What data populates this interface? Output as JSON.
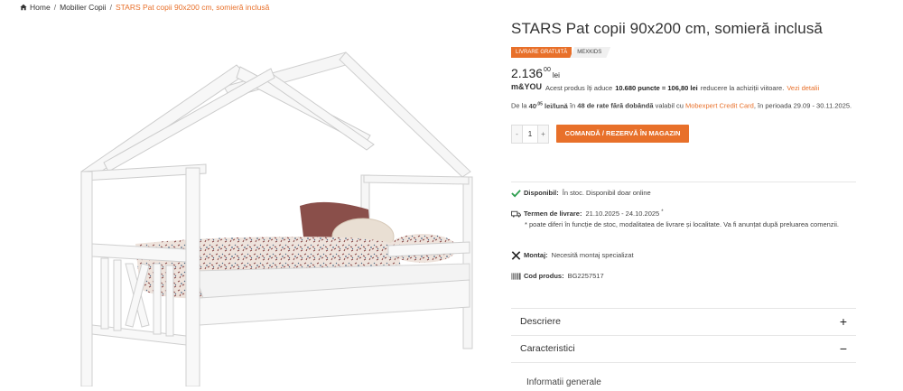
{
  "breadcrumb": {
    "home": "Home",
    "category": "Mobilier Copii",
    "current": "STARS Pat copii 90x200 cm, somieră inclusă",
    "separator": "/"
  },
  "product": {
    "title": "STARS Pat copii 90x200 cm, somieră inclusă",
    "badges": {
      "delivery": "Livrare gratuită",
      "brand": "MEXKIDS"
    },
    "price": {
      "integer": "2.136",
      "decimals": "00",
      "currency": "lei"
    }
  },
  "loyalty": {
    "logo_text": "m&YOU",
    "text_1": "Acest produs îți aduce",
    "points": "10.680 puncte = 106,80 lei",
    "text_2": "reducere la achiziții viitoare.",
    "link": "Vezi detalii"
  },
  "installments": {
    "prefix": "De la",
    "amount_int": "40",
    "amount_dec": ",05",
    "amount_suffix": "lei/lună",
    "in": "în",
    "count": "48 de rate fără dobândă",
    "valid": "valabil cu",
    "card": "Mobexpert Credit Card",
    "period": ", în perioada 29.09 - 30.11.2025."
  },
  "purchase": {
    "minus": "-",
    "quantity": "1",
    "plus": "+",
    "order_button": "Comandă / Rezervă în magazin"
  },
  "availability": {
    "label": "Disponibil:",
    "value": "În stoc. Disponibil doar online"
  },
  "delivery_term": {
    "label": "Termen de livrare:",
    "value": "21.10.2025 - 24.10.2025",
    "mark": "*",
    "note": "* poate diferi în funcție de stoc, modalitatea de livrare și localitate. Va fi anunțat după preluarea comenzii."
  },
  "assembly": {
    "label": "Montaj:",
    "value": "Necesită montaj specializat"
  },
  "product_code": {
    "label": "Cod produs:",
    "value": "BG2257517"
  },
  "accordion": [
    {
      "label": "Descriere",
      "sign": "+"
    },
    {
      "label": "Caracteristici",
      "sign": "−"
    }
  ],
  "accordion_sub": "Informatii generale",
  "colors": {
    "accent": "#e8702a",
    "success": "#2e9e4f",
    "text": "#333333"
  },
  "icons": [
    "home-icon",
    "check-icon",
    "truck-icon",
    "tools-icon",
    "barcode-icon",
    "plus-icon",
    "minus-icon"
  ]
}
